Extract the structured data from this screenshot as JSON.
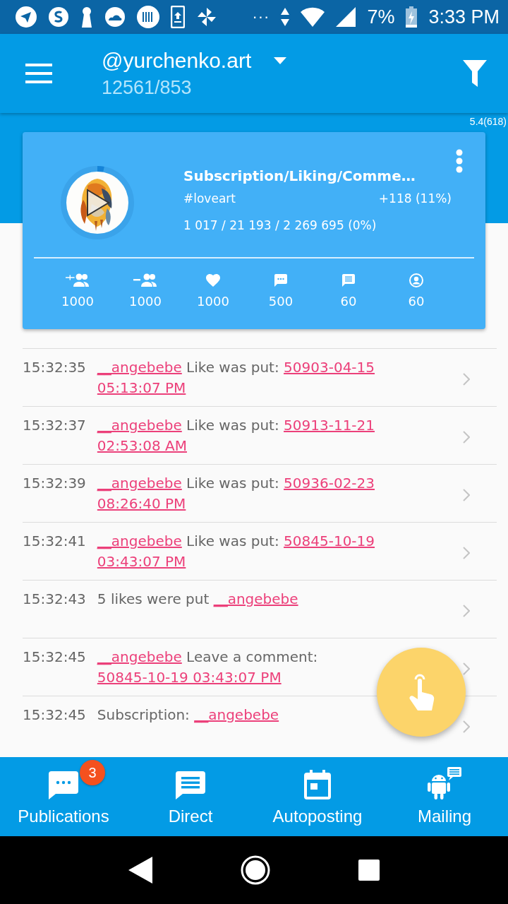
{
  "status_bar": {
    "more": "···",
    "battery": "7%",
    "time": "3:33 PM"
  },
  "app_bar": {
    "account": "@yurchenko.art",
    "counts": "12561/853"
  },
  "version": "5.4(618)",
  "task_card": {
    "title": "Subscription/Liking/Comme…",
    "hashtag": "#loveart",
    "growth": "+118 (11%)",
    "totals": "1 017 / 21 193 / 2 269 695 (0%)",
    "progress": {
      "level": 0.03
    },
    "limits": [
      {
        "kind": "follow",
        "value": "1000"
      },
      {
        "kind": "unfollow",
        "value": "1000"
      },
      {
        "kind": "like",
        "value": "1000"
      },
      {
        "kind": "comment",
        "value": "500"
      },
      {
        "kind": "message",
        "value": "60"
      },
      {
        "kind": "story",
        "value": "60"
      }
    ]
  },
  "log": [
    {
      "time": "15:32:35",
      "parts": [
        {
          "kind": "user",
          "text": "__angebebe"
        },
        {
          "kind": "text",
          "text": " Like was put: "
        },
        {
          "kind": "date",
          "text": "50903-04-15"
        },
        {
          "kind": "date",
          "text": "05:13:07 PM"
        }
      ]
    },
    {
      "time": "15:32:37",
      "parts": [
        {
          "kind": "user",
          "text": "__angebebe"
        },
        {
          "kind": "text",
          "text": " Like was put: "
        },
        {
          "kind": "date",
          "text": "50913-11-21"
        },
        {
          "kind": "date",
          "text": "02:53:08 AM"
        }
      ]
    },
    {
      "time": "15:32:39",
      "parts": [
        {
          "kind": "user",
          "text": "__angebebe"
        },
        {
          "kind": "text",
          "text": " Like was put: "
        },
        {
          "kind": "date",
          "text": "50936-02-23"
        },
        {
          "kind": "date",
          "text": "08:26:40 PM"
        }
      ]
    },
    {
      "time": "15:32:41",
      "parts": [
        {
          "kind": "user",
          "text": "__angebebe"
        },
        {
          "kind": "text",
          "text": " Like was put: "
        },
        {
          "kind": "date",
          "text": "50845-10-19"
        },
        {
          "kind": "date",
          "text": "03:43:07 PM"
        }
      ]
    },
    {
      "time": "15:32:43",
      "parts": [
        {
          "kind": "text",
          "text": "5 likes were put "
        },
        {
          "kind": "user",
          "text": "__angebebe"
        }
      ]
    },
    {
      "time": "15:32:45",
      "parts": [
        {
          "kind": "user",
          "text": "__angebebe"
        },
        {
          "kind": "text",
          "text": " Leave a comment: "
        },
        {
          "kind": "date",
          "text": "50845-10-19 03:43:07 PM"
        }
      ]
    },
    {
      "time": "15:32:45",
      "parts": [
        {
          "kind": "text",
          "text": "Subscription: "
        },
        {
          "kind": "user",
          "text": "__angebebe"
        }
      ]
    }
  ],
  "nav": [
    {
      "kind": "chat",
      "label": "Publications",
      "badge": "3"
    },
    {
      "kind": "message",
      "label": "Direct"
    },
    {
      "kind": "calendar",
      "label": "Autoposting"
    },
    {
      "kind": "robot",
      "label": "Mailing"
    }
  ]
}
